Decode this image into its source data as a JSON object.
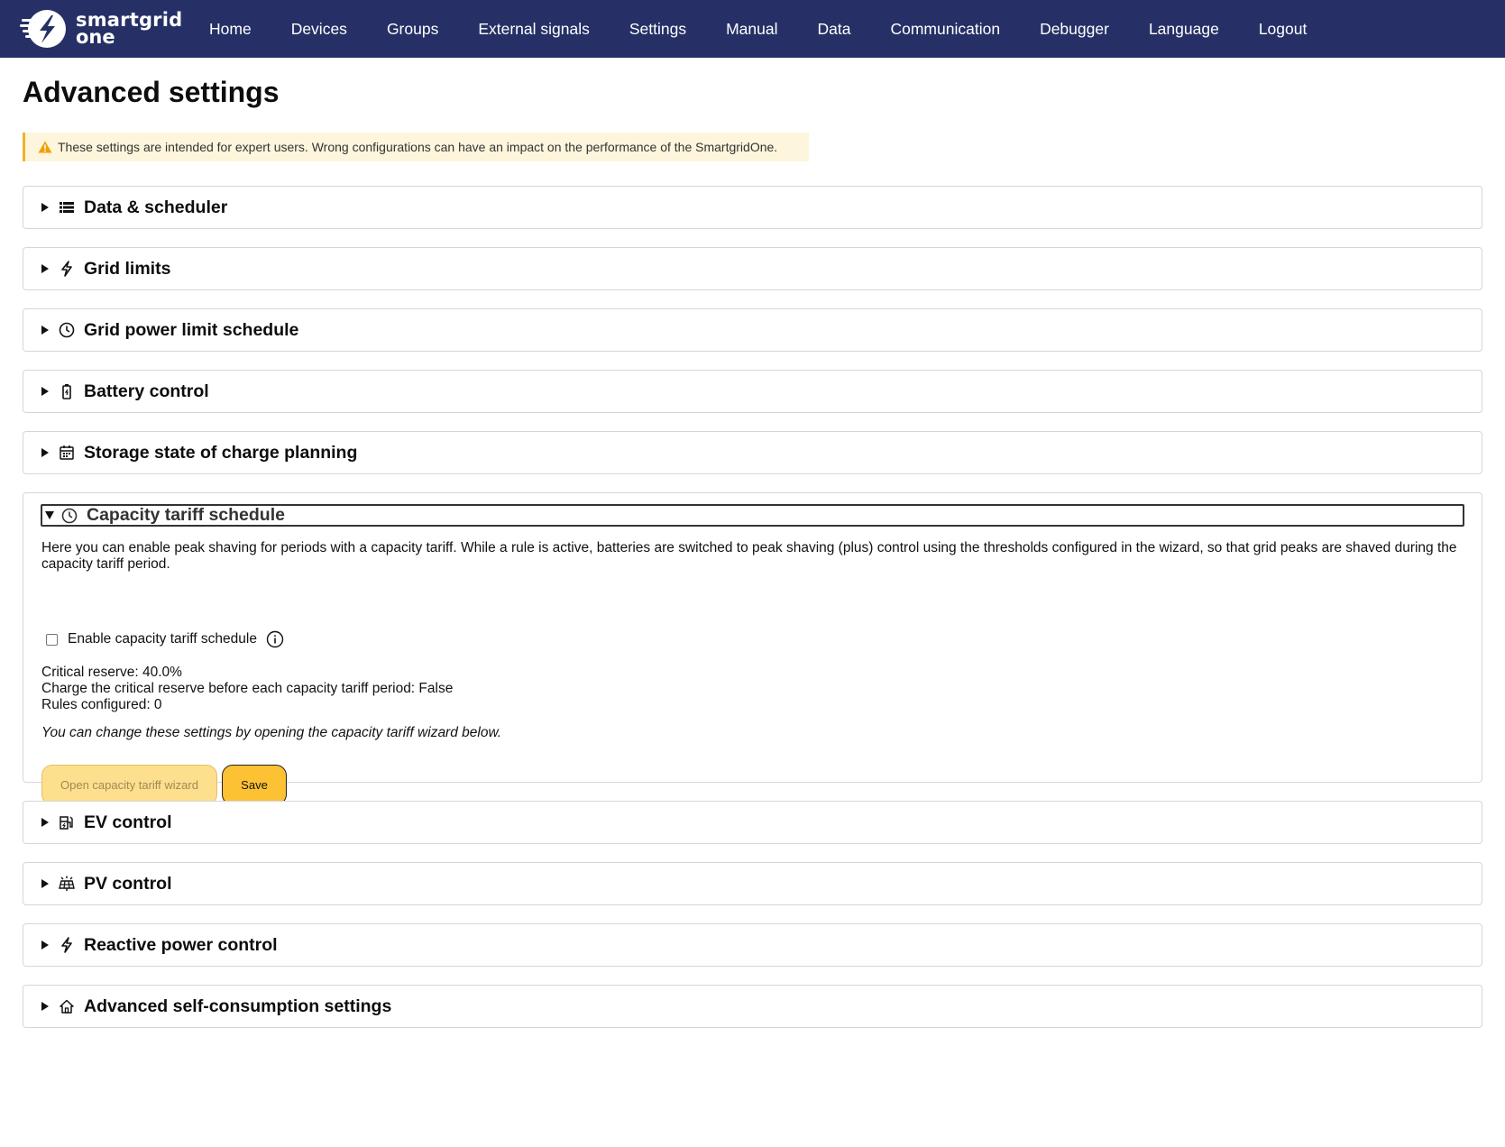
{
  "app": {
    "logo_line1": "smartgrid",
    "logo_line2": "one",
    "brand_color": "#263066",
    "accent_color": "#fcc233"
  },
  "nav": {
    "items": [
      "Home",
      "Devices",
      "Groups",
      "External signals",
      "Settings",
      "Manual",
      "Data",
      "Communication",
      "Debugger",
      "Language",
      "Logout"
    ]
  },
  "page": {
    "title": "Advanced settings",
    "warning": "These settings are intended for expert users. Wrong configurations can have an impact on the performance of the SmartgridOne."
  },
  "sections": [
    {
      "title": "Data & scheduler",
      "icon": "list-icon",
      "expanded": false
    },
    {
      "title": "Grid limits",
      "icon": "lightning-icon",
      "expanded": false
    },
    {
      "title": "Grid power limit schedule",
      "icon": "clock-icon",
      "expanded": false
    },
    {
      "title": "Battery control",
      "icon": "battery-icon",
      "expanded": false
    },
    {
      "title": "Storage state of charge planning",
      "icon": "calendar-icon",
      "expanded": false
    },
    {
      "title": "Capacity tariff schedule",
      "icon": "clock-icon",
      "expanded": true
    },
    {
      "title": "EV control",
      "icon": "ev-charger-icon",
      "expanded": false
    },
    {
      "title": "PV control",
      "icon": "solar-panel-icon",
      "expanded": false
    },
    {
      "title": "Reactive power control",
      "icon": "lightning-icon",
      "expanded": false
    },
    {
      "title": "Advanced self-consumption settings",
      "icon": "home-icon",
      "expanded": false
    }
  ],
  "capacity_tariff": {
    "description": "Here you can enable peak shaving for periods with a capacity tariff. While a rule is active, batteries are switched to peak shaving (plus) control using the thresholds configured in the wizard, so that grid peaks are shaved during the capacity tariff period.",
    "checkbox_label": "Enable capacity tariff schedule",
    "checkbox_checked": false,
    "critical_reserve": "Critical reserve: 40.0%",
    "charge_reserve": "Charge the critical reserve before each capacity tariff period: False",
    "rules_configured": "Rules configured: 0",
    "note": "You can change these settings by opening the capacity tariff wizard below.",
    "wizard_button": "Open capacity tariff wizard",
    "save_button": "Save"
  }
}
